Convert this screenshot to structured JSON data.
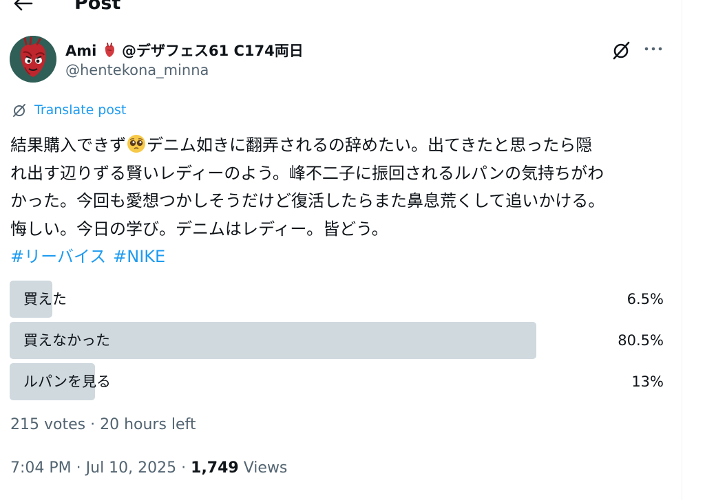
{
  "header": {
    "title": "Post",
    "back_icon": "arrow-left-icon"
  },
  "author": {
    "name": "Ami",
    "name_suffix": "@デザフェス61 C174両日",
    "handle": "@hentekona_minna",
    "avatar_icon": "anatomical-heart-avatar",
    "name_emoji": "anatomical-heart-icon"
  },
  "actions": {
    "grok_icon": "grok-icon",
    "more_icon": "more-icon"
  },
  "translate": {
    "label": "Translate post"
  },
  "post": {
    "line1_a": "結果購入できず",
    "line1_emoji": "pleading-face-icon",
    "line1_b": "デニム如きに翻弄されるの辞めたい。出てきたと思ったら隠",
    "line2": "れ出す辺りずる賢いレディーのよう。峰不二子に振回されるルパンの気持ちがわ",
    "line3": "かった。今回も愛想つかしそうだけど復活したらまた鼻息荒くして追いかける。",
    "line4": "悔しい。今日の学び。デニムはレディー。皆どう。",
    "hashtags": [
      "#リーバイス",
      "#NIKE"
    ]
  },
  "poll": {
    "options": [
      {
        "label": "買えた",
        "percent_text": "6.5%",
        "value": 6.5
      },
      {
        "label": "買えなかった",
        "percent_text": "80.5%",
        "value": 80.5
      },
      {
        "label": "ルパンを見る",
        "percent_text": "13%",
        "value": 13
      }
    ],
    "votes": "215 votes",
    "separator": " · ",
    "time_left": "20 hours left"
  },
  "meta": {
    "time": "7:04 PM",
    "separator": " · ",
    "date": "Jul 10, 2025",
    "views_count": "1,749",
    "views_label": " Views"
  },
  "colors": {
    "accent": "#1d9bf0",
    "text": "#0f1419",
    "secondary": "#536471",
    "poll_bar": "#cfd9de"
  }
}
